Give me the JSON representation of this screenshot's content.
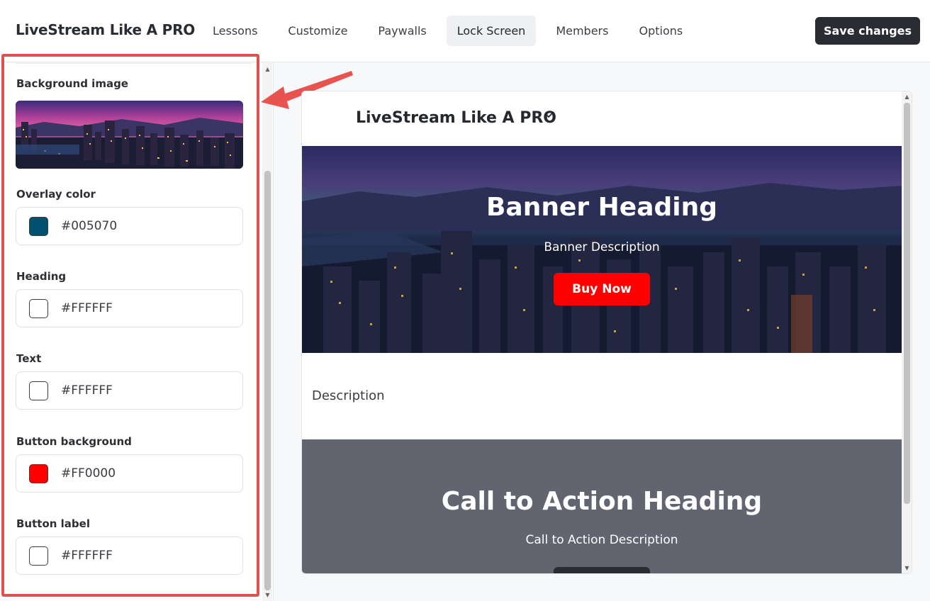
{
  "app": {
    "title": "LiveStream Like A PRO"
  },
  "nav": {
    "tabs": [
      {
        "label": "Lessons"
      },
      {
        "label": "Customize"
      },
      {
        "label": "Paywalls"
      },
      {
        "label": "Lock Screen",
        "active": true
      },
      {
        "label": "Members"
      },
      {
        "label": "Options"
      }
    ],
    "save_label": "Save changes"
  },
  "settings": {
    "background_image_label": "Background image",
    "fields": [
      {
        "label": "Overlay color",
        "value": "#005070",
        "swatch": "#005070"
      },
      {
        "label": "Heading",
        "value": "#FFFFFF",
        "swatch": "#FFFFFF"
      },
      {
        "label": "Text",
        "value": "#FFFFFF",
        "swatch": "#FFFFFF"
      },
      {
        "label": "Button background",
        "value": "#FF0000",
        "swatch": "#FF0000"
      },
      {
        "label": "Button label",
        "value": "#FFFFFF",
        "swatch": "#FFFFFF"
      }
    ]
  },
  "preview": {
    "course_title": "LiveStream Like A PRO",
    "chevron_icon": "chevron-down-icon",
    "banner": {
      "heading": "Banner Heading",
      "description": "Banner Description",
      "button_label": "Buy Now"
    },
    "description": "Description",
    "cta": {
      "heading": "Call to Action Heading",
      "description": "Call to Action Description"
    }
  },
  "colors": {
    "accent_red": "#FF0000",
    "dark_button": "#2A2C31",
    "cta_background": "#62646F",
    "annotation_red": "#E05050"
  }
}
